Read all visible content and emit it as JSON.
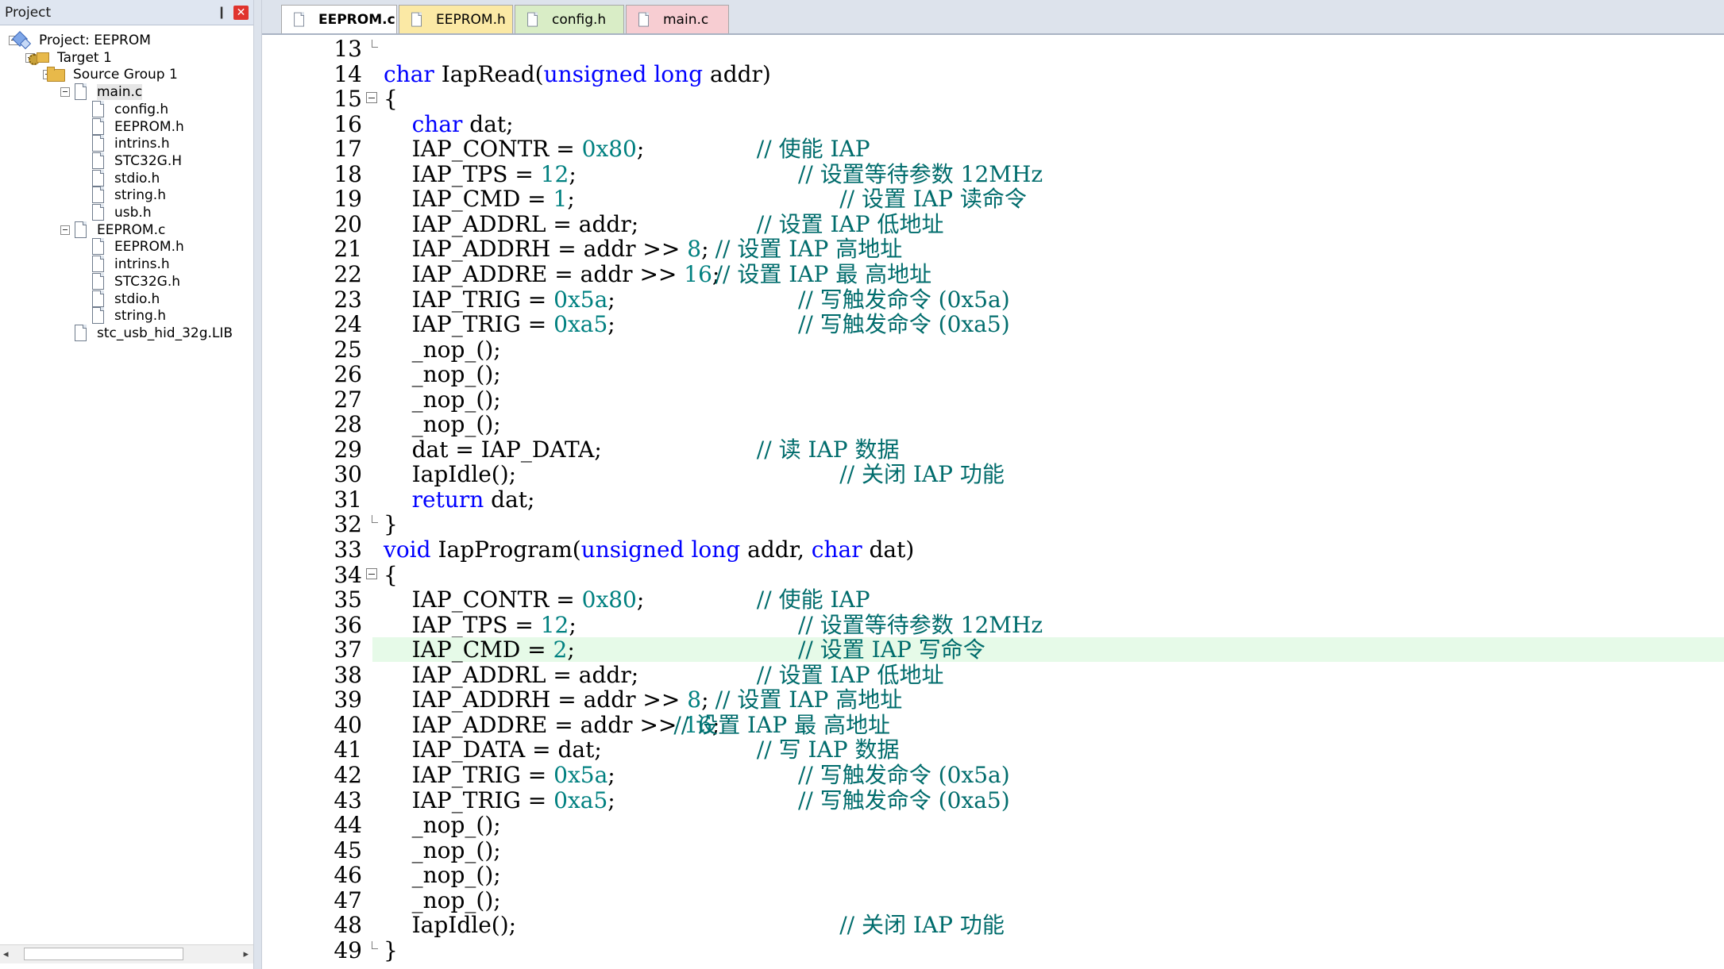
{
  "project_panel": {
    "title": "Project",
    "pin_glyph": "❙",
    "close_glyph": "✕",
    "tree": [
      {
        "label": "Project: EEPROM",
        "icon": "project-icon",
        "level": 0,
        "expander": true
      },
      {
        "label": "Target 1",
        "icon": "target-icon",
        "level": 1,
        "expander": true
      },
      {
        "label": "Source Group 1",
        "icon": "folder-icon",
        "level": 2,
        "expander": true
      },
      {
        "label": "main.c",
        "icon": "file-icon",
        "level": 3,
        "expander": true,
        "selected": true
      },
      {
        "label": "config.h",
        "icon": "file-icon",
        "level": 4
      },
      {
        "label": "EEPROM.h",
        "icon": "file-icon",
        "level": 4
      },
      {
        "label": "intrins.h",
        "icon": "file-icon",
        "level": 4
      },
      {
        "label": "STC32G.H",
        "icon": "file-icon",
        "level": 4
      },
      {
        "label": "stdio.h",
        "icon": "file-icon",
        "level": 4
      },
      {
        "label": "string.h",
        "icon": "file-icon",
        "level": 4
      },
      {
        "label": "usb.h",
        "icon": "file-icon",
        "level": 4
      },
      {
        "label": "EEPROM.c",
        "icon": "file-icon",
        "level": 3,
        "expander": true
      },
      {
        "label": "EEPROM.h",
        "icon": "file-icon",
        "level": 4
      },
      {
        "label": "intrins.h",
        "icon": "file-icon",
        "level": 4
      },
      {
        "label": "STC32G.h",
        "icon": "file-icon",
        "level": 4
      },
      {
        "label": "stdio.h",
        "icon": "file-icon",
        "level": 4
      },
      {
        "label": "string.h",
        "icon": "file-icon",
        "level": 4
      },
      {
        "label": "stc_usb_hid_32g.LIB",
        "icon": "file-icon",
        "level": 3
      }
    ],
    "scroll_left": "◂",
    "scroll_right": "▸"
  },
  "tabs": [
    {
      "label": "EEPROM.c",
      "active": true,
      "color": "#ffffff"
    },
    {
      "label": "EEPROM.h",
      "active": false,
      "color": "#fbe9a5"
    },
    {
      "label": "config.h",
      "active": false,
      "color": "#d9edc6"
    },
    {
      "label": "main.c",
      "active": false,
      "color": "#f7cdd2"
    }
  ],
  "editor": {
    "highlight_color": "#e6fae8",
    "keyword_color": "#0000ff",
    "number_color": "#008080",
    "comment_color": "#006c6c",
    "lines": [
      {
        "n": "13",
        "code": [],
        "comment": "",
        "fold": "end"
      },
      {
        "n": "14",
        "code": [
          [
            "kw",
            "char"
          ],
          [
            "t",
            " IapRead("
          ],
          [
            "kw",
            "unsigned long"
          ],
          [
            "t",
            " addr)"
          ]
        ],
        "comment": ""
      },
      {
        "n": "15",
        "code": [
          [
            "t",
            "{"
          ]
        ],
        "comment": "",
        "fold": "box"
      },
      {
        "n": "16",
        "code": [
          [
            "t",
            "    "
          ],
          [
            "kw",
            "char"
          ],
          [
            "t",
            " dat;"
          ]
        ],
        "comment": ""
      },
      {
        "n": "17",
        "code": [
          [
            "t",
            "    IAP_CONTR = "
          ],
          [
            "num",
            "0x80"
          ],
          [
            "t",
            ";"
          ]
        ],
        "comment": "// 使能 IAP",
        "ccol": 36
      },
      {
        "n": "18",
        "code": [
          [
            "t",
            "    IAP_TPS = "
          ],
          [
            "num",
            "12"
          ],
          [
            "t",
            ";"
          ]
        ],
        "comment": "// 设置等待参数 12MHz",
        "ccol": 40
      },
      {
        "n": "19",
        "code": [
          [
            "t",
            "    IAP_CMD = "
          ],
          [
            "num",
            "1"
          ],
          [
            "t",
            ";"
          ]
        ],
        "comment": "// 设置 IAP 读命令",
        "ccol": 44
      },
      {
        "n": "20",
        "code": [
          [
            "t",
            "    IAP_ADDRL = addr;"
          ]
        ],
        "comment": "// 设置 IAP 低地址",
        "ccol": 36
      },
      {
        "n": "21",
        "code": [
          [
            "t",
            "    IAP_ADDRH = addr >> "
          ],
          [
            "num",
            "8"
          ],
          [
            "t",
            ";"
          ]
        ],
        "comment": "// 设置 IAP 高地址",
        "ccol": 32
      },
      {
        "n": "22",
        "code": [
          [
            "t",
            "    IAP_ADDRE = addr >> "
          ],
          [
            "num",
            "16"
          ],
          [
            "t",
            ";"
          ]
        ],
        "comment": "// 设置 IAP 最 高地址",
        "ccol": 32
      },
      {
        "n": "23",
        "code": [
          [
            "t",
            "    IAP_TRIG = "
          ],
          [
            "num",
            "0x5a"
          ],
          [
            "t",
            ";"
          ]
        ],
        "comment": "// 写触发命令 (0x5a)",
        "ccol": 40
      },
      {
        "n": "24",
        "code": [
          [
            "t",
            "    IAP_TRIG = "
          ],
          [
            "num",
            "0xa5"
          ],
          [
            "t",
            ";"
          ]
        ],
        "comment": "// 写触发命令 (0xa5)",
        "ccol": 40
      },
      {
        "n": "25",
        "code": [
          [
            "t",
            "    _nop_();"
          ]
        ],
        "comment": ""
      },
      {
        "n": "26",
        "code": [
          [
            "t",
            "    _nop_();"
          ]
        ],
        "comment": ""
      },
      {
        "n": "27",
        "code": [
          [
            "t",
            "    _nop_();"
          ]
        ],
        "comment": ""
      },
      {
        "n": "28",
        "code": [
          [
            "t",
            "    _nop_();"
          ]
        ],
        "comment": ""
      },
      {
        "n": "29",
        "code": [
          [
            "t",
            "    dat = IAP_DATA;"
          ]
        ],
        "comment": "// 读 IAP 数据",
        "ccol": 36
      },
      {
        "n": "30",
        "code": [
          [
            "t",
            "    IapIdle();"
          ]
        ],
        "comment": "// 关闭 IAP 功能",
        "ccol": 44
      },
      {
        "n": "31",
        "code": [
          [
            "t",
            "    "
          ],
          [
            "kw",
            "return"
          ],
          [
            "t",
            " dat;"
          ]
        ],
        "comment": ""
      },
      {
        "n": "32",
        "code": [
          [
            "t",
            "}"
          ]
        ],
        "comment": "",
        "fold": "end"
      },
      {
        "n": "33",
        "code": [
          [
            "kw",
            "void"
          ],
          [
            "t",
            " IapProgram("
          ],
          [
            "kw",
            "unsigned long"
          ],
          [
            "t",
            " addr, "
          ],
          [
            "kw",
            "char"
          ],
          [
            "t",
            " dat)"
          ]
        ],
        "comment": ""
      },
      {
        "n": "34",
        "code": [
          [
            "t",
            "{"
          ]
        ],
        "comment": "",
        "fold": "box"
      },
      {
        "n": "35",
        "code": [
          [
            "t",
            "    IAP_CONTR = "
          ],
          [
            "num",
            "0x80"
          ],
          [
            "t",
            ";"
          ]
        ],
        "comment": "// 使能 IAP",
        "ccol": 36
      },
      {
        "n": "36",
        "code": [
          [
            "t",
            "    IAP_TPS = "
          ],
          [
            "num",
            "12"
          ],
          [
            "t",
            ";"
          ]
        ],
        "comment": "// 设置等待参数 12MHz",
        "ccol": 40
      },
      {
        "n": "37",
        "code": [
          [
            "t",
            "    IAP_CMD = "
          ],
          [
            "num",
            "2"
          ],
          [
            "t",
            ";"
          ]
        ],
        "comment": "// 设置 IAP 写命令",
        "ccol": 40,
        "highlight": true
      },
      {
        "n": "38",
        "code": [
          [
            "t",
            "    IAP_ADDRL = addr;"
          ]
        ],
        "comment": "// 设置 IAP 低地址",
        "ccol": 36
      },
      {
        "n": "39",
        "code": [
          [
            "t",
            "    IAP_ADDRH = addr >> "
          ],
          [
            "num",
            "8"
          ],
          [
            "t",
            ";"
          ]
        ],
        "comment": "// 设置 IAP 高地址",
        "ccol": 32
      },
      {
        "n": "40",
        "code": [
          [
            "t",
            "    IAP_ADDRE = addr >> "
          ],
          [
            "num",
            "16"
          ],
          [
            "t",
            ";"
          ]
        ],
        "comment": "// 设置 IAP 最 高地址",
        "ccol": 28
      },
      {
        "n": "41",
        "code": [
          [
            "t",
            "    IAP_DATA = dat;"
          ]
        ],
        "comment": "// 写 IAP 数据",
        "ccol": 36
      },
      {
        "n": "42",
        "code": [
          [
            "t",
            "    IAP_TRIG = "
          ],
          [
            "num",
            "0x5a"
          ],
          [
            "t",
            ";"
          ]
        ],
        "comment": "// 写触发命令 (0x5a)",
        "ccol": 40
      },
      {
        "n": "43",
        "code": [
          [
            "t",
            "    IAP_TRIG = "
          ],
          [
            "num",
            "0xa5"
          ],
          [
            "t",
            ";"
          ]
        ],
        "comment": "// 写触发命令 (0xa5)",
        "ccol": 40
      },
      {
        "n": "44",
        "code": [
          [
            "t",
            "    _nop_();"
          ]
        ],
        "comment": ""
      },
      {
        "n": "45",
        "code": [
          [
            "t",
            "    _nop_();"
          ]
        ],
        "comment": ""
      },
      {
        "n": "46",
        "code": [
          [
            "t",
            "    _nop_();"
          ]
        ],
        "comment": ""
      },
      {
        "n": "47",
        "code": [
          [
            "t",
            "    _nop_();"
          ]
        ],
        "comment": ""
      },
      {
        "n": "48",
        "code": [
          [
            "t",
            "    IapIdle();"
          ]
        ],
        "comment": "// 关闭 IAP 功能",
        "ccol": 44
      },
      {
        "n": "49",
        "code": [
          [
            "t",
            "}"
          ]
        ],
        "comment": "",
        "fold": "end"
      }
    ]
  }
}
